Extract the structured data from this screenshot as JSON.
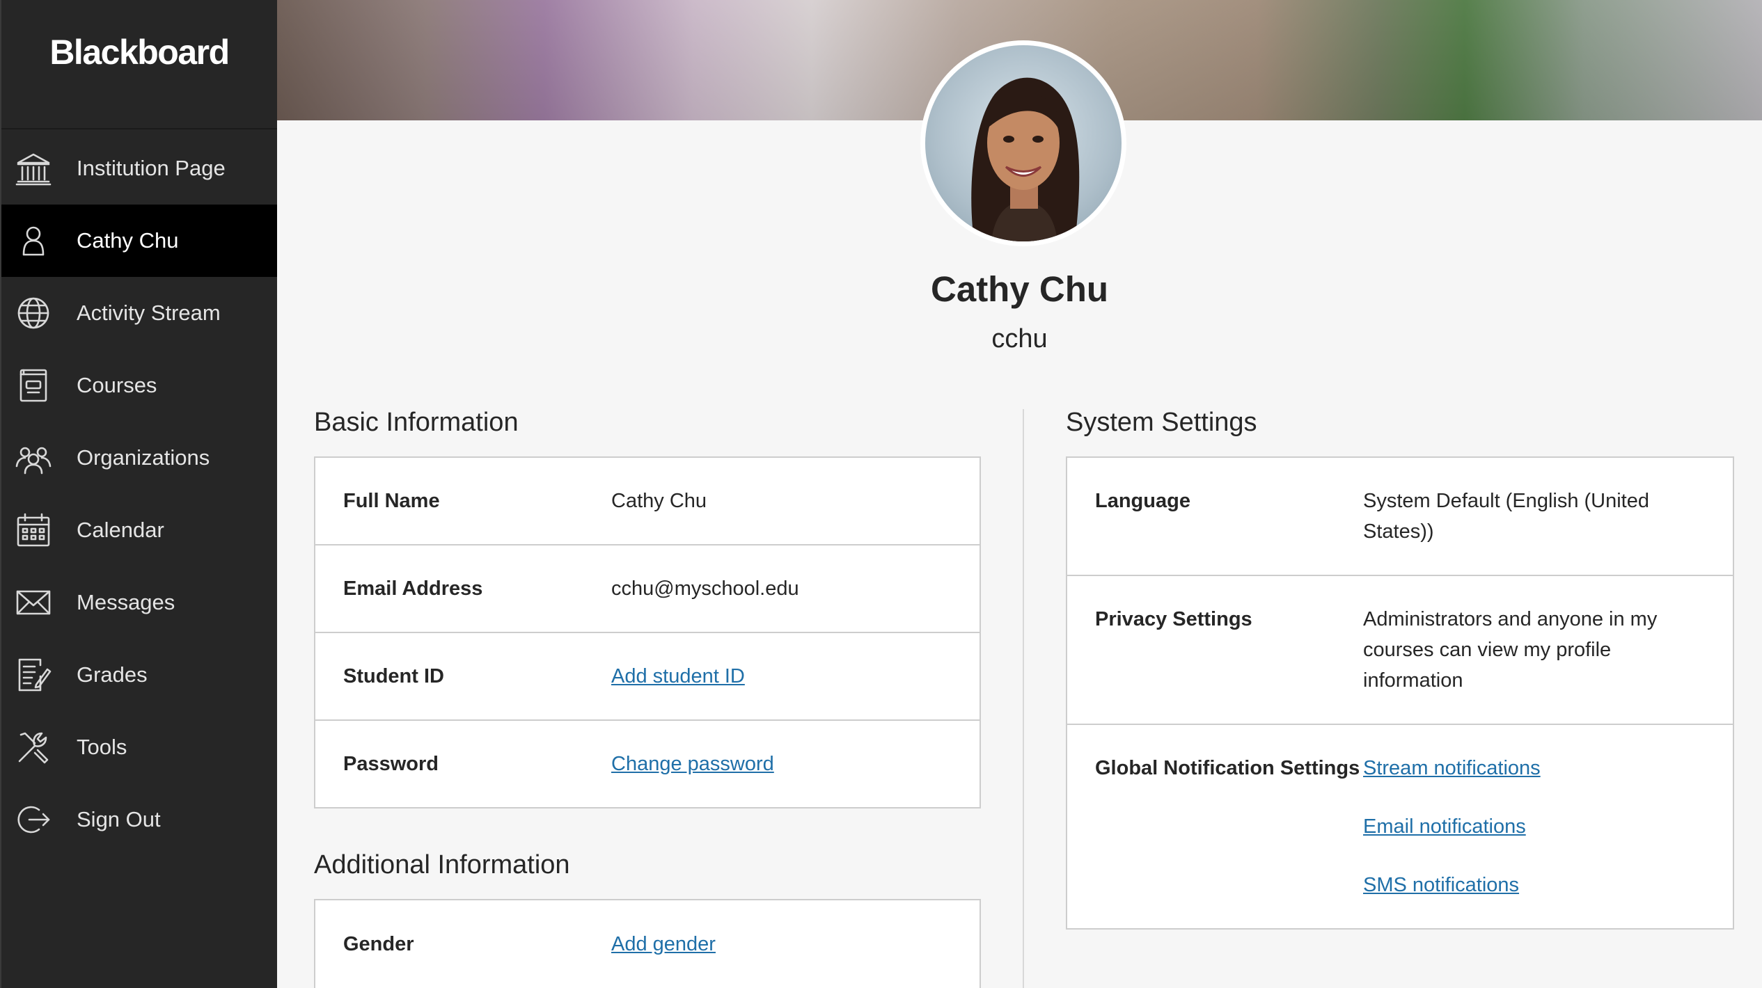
{
  "app": {
    "logo_text": "Blackboard"
  },
  "sidebar": {
    "items": [
      {
        "label": "Institution Page",
        "icon": "institution-icon"
      },
      {
        "label": "Cathy Chu",
        "icon": "user-icon",
        "active": true
      },
      {
        "label": "Activity Stream",
        "icon": "globe-icon"
      },
      {
        "label": "Courses",
        "icon": "courses-icon"
      },
      {
        "label": "Organizations",
        "icon": "organizations-icon"
      },
      {
        "label": "Calendar",
        "icon": "calendar-icon"
      },
      {
        "label": "Messages",
        "icon": "envelope-icon"
      },
      {
        "label": "Grades",
        "icon": "grades-icon"
      },
      {
        "label": "Tools",
        "icon": "tools-icon"
      },
      {
        "label": "Sign Out",
        "icon": "sign-out-icon"
      }
    ]
  },
  "profile": {
    "name": "Cathy Chu",
    "username": "cchu"
  },
  "basic_info": {
    "title": "Basic Information",
    "rows": [
      {
        "label": "Full Name",
        "value": "Cathy Chu"
      },
      {
        "label": "Email Address",
        "value": "cchu@myschool.edu"
      },
      {
        "label": "Student ID",
        "value": "Add student ID"
      },
      {
        "label": "Password",
        "value": "Change password"
      }
    ]
  },
  "additional_info": {
    "title": "Additional Information",
    "rows": [
      {
        "label": "Gender",
        "value": "Add gender"
      }
    ]
  },
  "system_settings": {
    "title": "System Settings",
    "language": {
      "label": "Language",
      "value": "System Default (English (United States))"
    },
    "privacy": {
      "label": "Privacy Settings",
      "value": "Administrators and anyone in my courses can view my profile information"
    },
    "notifications": {
      "label": "Global Notification Settings",
      "links": [
        "Stream notifications",
        "Email notifications",
        "SMS notifications"
      ]
    }
  },
  "colors": {
    "sidebar_bg": "#262626",
    "active_bg": "#000000",
    "link": "#1f6fa8",
    "page_bg": "#f6f6f6"
  }
}
